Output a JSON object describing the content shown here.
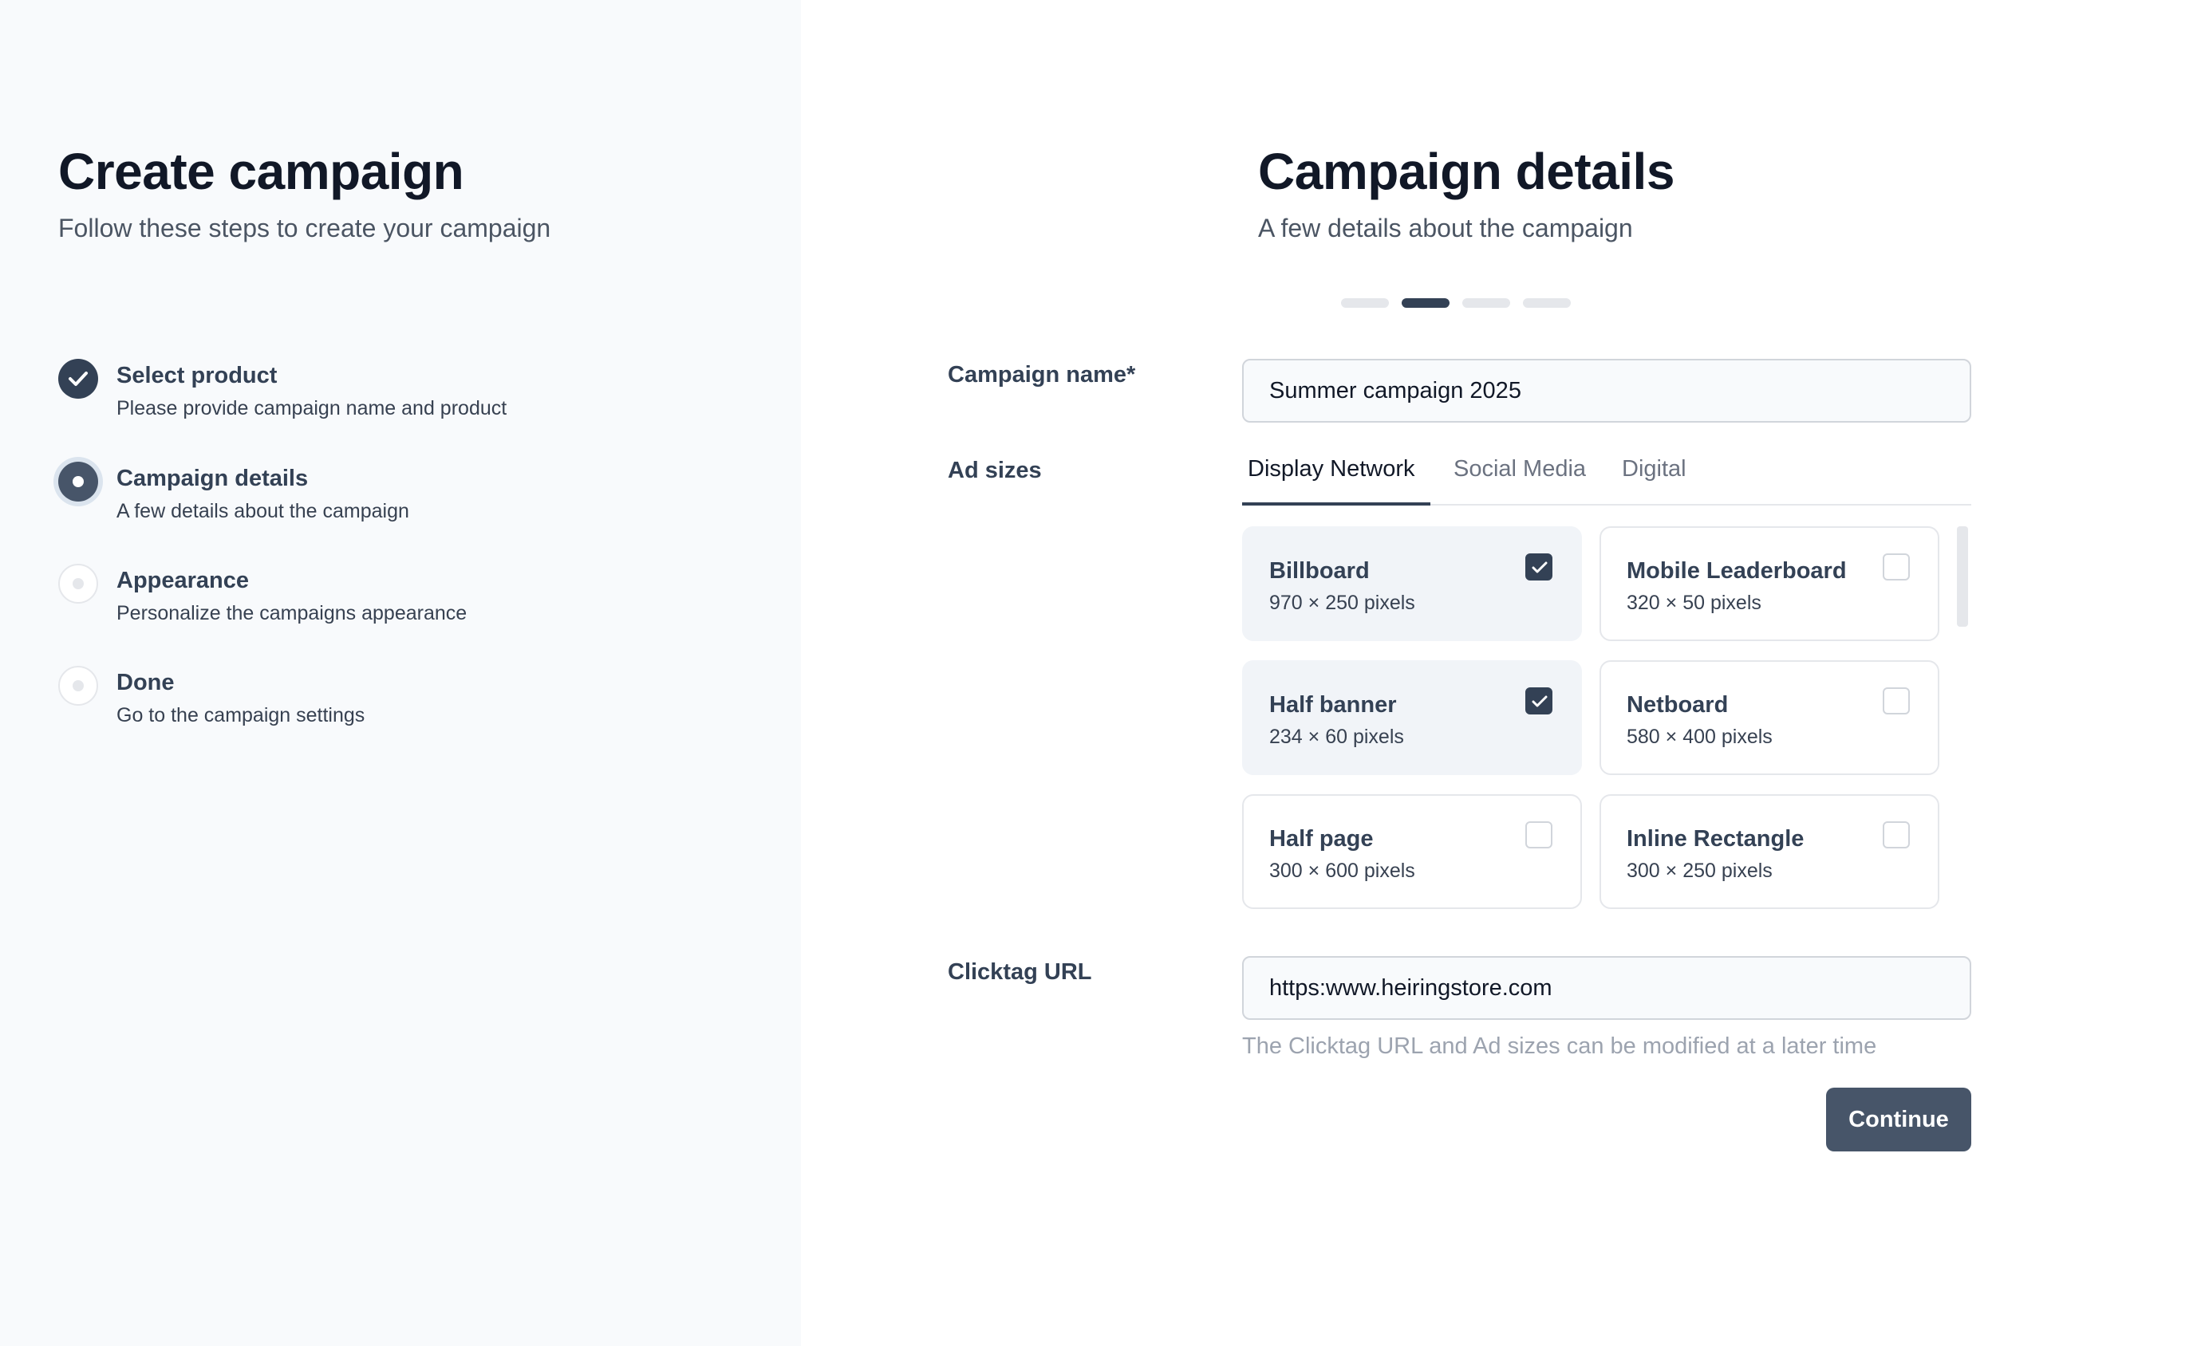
{
  "sidebar": {
    "title": "Create campaign",
    "subtitle": "Follow these steps to create your campaign",
    "steps": [
      {
        "title": "Select product",
        "desc": "Please provide campaign name and product",
        "state": "done"
      },
      {
        "title": "Campaign details",
        "desc": "A few details about the campaign",
        "state": "current"
      },
      {
        "title": "Appearance",
        "desc": "Personalize the campaigns appearance",
        "state": "upcoming"
      },
      {
        "title": "Done",
        "desc": "Go to the campaign settings",
        "state": "upcoming"
      }
    ]
  },
  "main": {
    "title": "Campaign details",
    "subtitle": "A few details about the campaign",
    "progress": {
      "current_step": 2,
      "total_steps": 4
    },
    "campaign_name": {
      "label": "Campaign name*",
      "value": "Summer campaign 2025"
    },
    "ad_sizes": {
      "label": "Ad sizes",
      "tabs": [
        "Display Network",
        "Social Media",
        "Digital"
      ],
      "active_tab": "Display Network",
      "options": [
        {
          "name": "Billboard",
          "size": "970 × 250 pixels",
          "checked": true
        },
        {
          "name": "Mobile Leaderboard",
          "size": "320 × 50 pixels",
          "checked": false
        },
        {
          "name": "Half banner",
          "size": "234 × 60 pixels",
          "checked": true
        },
        {
          "name": "Netboard",
          "size": "580 × 400 pixels",
          "checked": false
        },
        {
          "name": "Half page",
          "size": "300 × 600 pixels",
          "checked": false
        },
        {
          "name": "Inline Rectangle",
          "size": "300 × 250 pixels",
          "checked": false
        }
      ]
    },
    "clicktag": {
      "label": "Clicktag URL",
      "value": "https:www.heiringstore.com",
      "hint": "The Clicktag URL and Ad sizes can be modified at a later time"
    },
    "continue_label": "Continue"
  },
  "colors": {
    "primary": "#334155",
    "button": "#475569",
    "sidebar_bg": "#f8fafc",
    "selected_card_bg": "#f1f4f8"
  },
  "icons": {
    "step_done": "check-icon",
    "checkbox_checked": "check-icon"
  }
}
